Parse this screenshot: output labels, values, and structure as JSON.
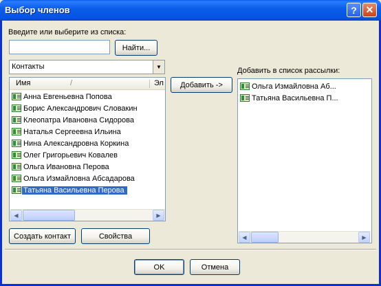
{
  "window": {
    "title": "Выбор членов",
    "help_glyph": "?",
    "close_glyph": "✕"
  },
  "search": {
    "label": "Введите или выберите из списка:",
    "value": "",
    "find_button": "Найти..."
  },
  "address_book": {
    "selected": "Контакты"
  },
  "contacts": {
    "columns": [
      "Имя",
      "Эл"
    ],
    "sort_indicator": "/",
    "items": [
      "Анна Евгеньевна Попова",
      "Борис Александрович Словакин",
      "Клеопатра Ивановна Сидорова",
      "Наталья Сергеевна Ильина",
      "Нина Александровна Коркина",
      "Олег Григорьевич Ковалев",
      "Ольга Ивановна Перова",
      "Ольга Измайловна Абсадарова",
      "Татьяна Васильевна Перова"
    ],
    "selected_index": 8
  },
  "add_button": "Добавить ->",
  "distribution": {
    "label": "Добавить в список рассылки:",
    "items": [
      "Ольга Измайловна Аб...",
      "Татьяна Васильевна П..."
    ]
  },
  "buttons": {
    "create_contact": "Создать контакт",
    "properties": "Свойства",
    "ok": "OK",
    "cancel": "Отмена"
  },
  "icons": {
    "contact": "contact-card-icon",
    "dropdown": "chevron-down-icon",
    "scroll_left": "arrow-left-icon",
    "scroll_right": "arrow-right-icon"
  }
}
